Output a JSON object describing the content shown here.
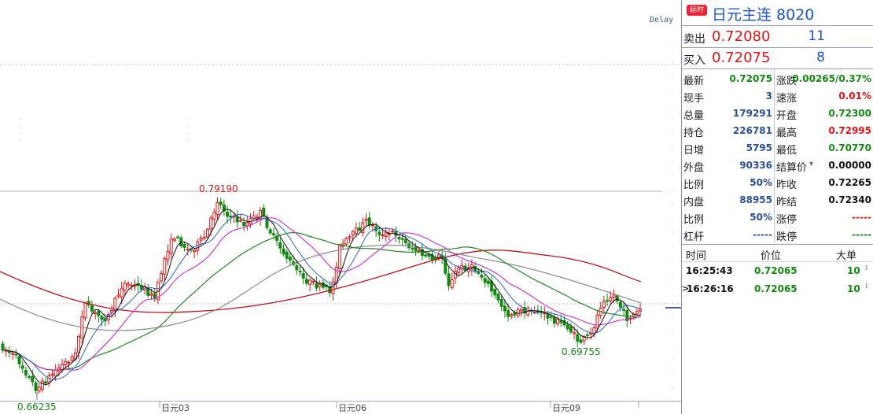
{
  "chart": {
    "delay_label": "Delay",
    "high_label": "0.79190",
    "low_label": "0.69755",
    "left_low_label": "0.66235",
    "x_ticks": [
      "日元03",
      "日元06",
      "日元09"
    ],
    "colors": {
      "up": "#e01515",
      "down": "#128a12",
      "ma_red": "#c0151a",
      "ma_gray": "#8c8c8c",
      "ma_green": "#1c8a1c",
      "ma_magenta": "#d02ad0",
      "ma_blue": "#2a64d8",
      "ma_black": "#111111"
    }
  },
  "header": {
    "badge": "延时",
    "title": "日元主连 8020"
  },
  "quote": {
    "sell_label": "卖出",
    "sell_price": "0.72080",
    "sell_vol": "11",
    "buy_label": "买入",
    "buy_price": "0.72075",
    "buy_vol": "8"
  },
  "stats_left": [
    {
      "label": "最新",
      "value": "0.72075",
      "color": "g"
    },
    {
      "label": "现手",
      "value": "3",
      "color": "b"
    },
    {
      "label": "总量",
      "value": "179291",
      "color": "b"
    },
    {
      "label": "持仓",
      "value": "226781",
      "color": "b"
    },
    {
      "label": "日增",
      "value": "5795",
      "color": "b"
    },
    {
      "label": "外盘",
      "value": "90336",
      "color": "b"
    },
    {
      "label": "比例",
      "value": "50%",
      "color": "b"
    },
    {
      "label": "内盘",
      "value": "88955",
      "color": "b"
    },
    {
      "label": "比例",
      "value": "50%",
      "color": "b"
    },
    {
      "label": "杠杆",
      "value": "-----",
      "color": "b"
    }
  ],
  "stats_right": [
    {
      "label": "涨跌",
      "value": "0.00265/0.37%",
      "color": "g"
    },
    {
      "label": "速涨",
      "value": "0.01%",
      "color": "r"
    },
    {
      "label": "开盘",
      "value": "0.72300",
      "color": "g"
    },
    {
      "label": "最高",
      "value": "0.72995",
      "color": "r"
    },
    {
      "label": "最低",
      "value": "0.70770",
      "color": "g"
    },
    {
      "label": "结算价",
      "value": "0.00000",
      "color": "k"
    },
    {
      "label": "昨收",
      "value": "0.72265",
      "color": "k"
    },
    {
      "label": "昨结",
      "value": "0.72340",
      "color": "k"
    },
    {
      "label": "涨停",
      "value": "-----",
      "color": "r"
    },
    {
      "label": "跌停",
      "value": "-----",
      "color": "g"
    }
  ],
  "trades": {
    "headers": {
      "time": "时间",
      "price": "价位",
      "size": "大单"
    },
    "rows": [
      {
        "time": "16:25:43",
        "price": "0.72065",
        "size": "10"
      },
      {
        "time": "16:26:16",
        "price": "0.72065",
        "size": "10"
      }
    ]
  }
}
